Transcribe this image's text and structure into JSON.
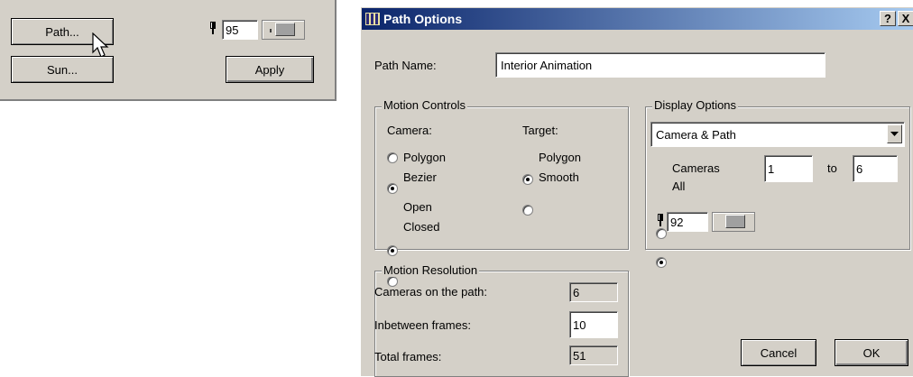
{
  "mini_panel": {
    "path_button": "Path...",
    "sun_button": "Sun...",
    "apply_button": "Apply",
    "value": "95"
  },
  "dialog": {
    "title": "Path Options",
    "help_button": "?",
    "close_button": "X",
    "path_name_label": "Path Name:",
    "path_name_value": "Interior Animation",
    "motion_controls": {
      "title": "Motion Controls",
      "camera_label": "Camera:",
      "target_label": "Target:",
      "camera_options": [
        {
          "label": "Polygon",
          "checked": false
        },
        {
          "label": "Bezier",
          "checked": true
        }
      ],
      "target_options": [
        {
          "label": "Polygon",
          "checked": true
        },
        {
          "label": "Smooth",
          "checked": false
        }
      ],
      "path_options": [
        {
          "label": "Open",
          "checked": true
        },
        {
          "label": "Closed",
          "checked": false
        }
      ]
    },
    "display_options": {
      "title": "Display Options",
      "selected": "Camera & Path",
      "cameras_label": "Cameras",
      "all_label": "All",
      "from_value": "1",
      "to_label": "to",
      "to_value": "6",
      "cameras_checked": false,
      "all_checked": true,
      "value": "92"
    },
    "motion_resolution": {
      "title": "Motion Resolution",
      "cameras_on_path_label": "Cameras on the path:",
      "cameras_on_path_value": "6",
      "inbetween_label": "Inbetween frames:",
      "inbetween_value": "10",
      "total_label": "Total frames:",
      "total_value": "51"
    },
    "cancel_button": "Cancel",
    "ok_button": "OK"
  },
  "colors": {
    "face": "#d4d0c8",
    "title_start": "#0a246a",
    "title_end": "#a6caf0"
  }
}
